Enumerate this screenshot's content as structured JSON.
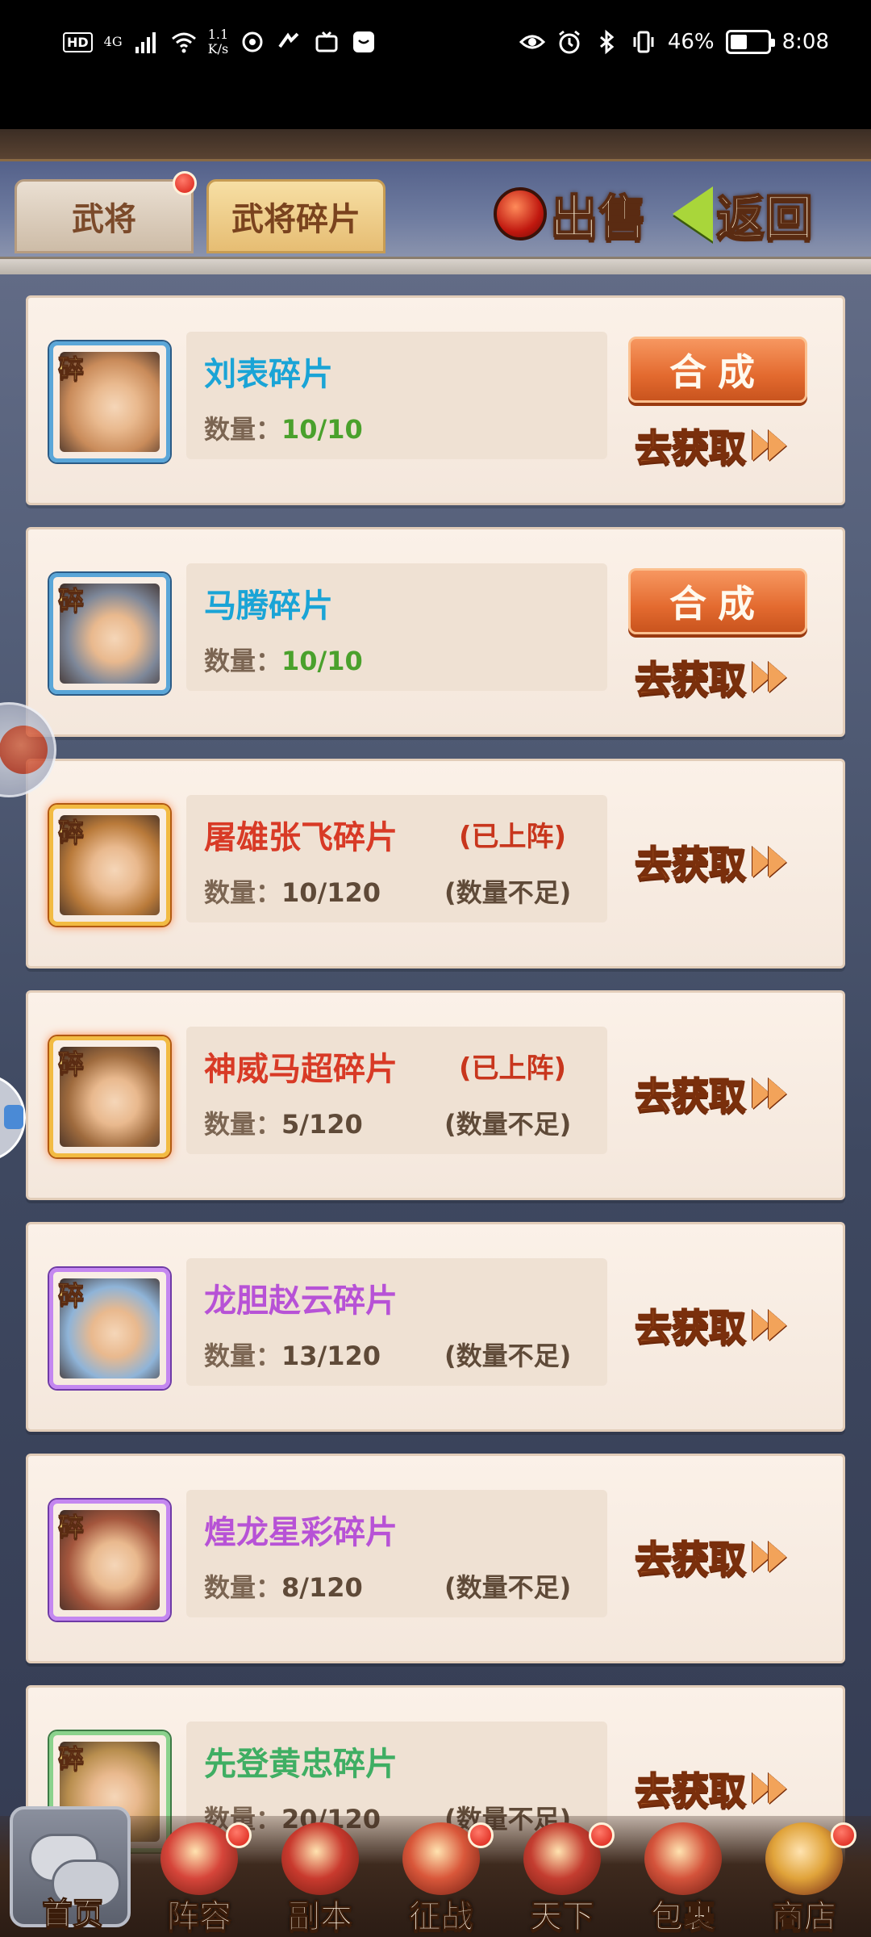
{
  "status_bar": {
    "hd": "HD",
    "signal": "4G",
    "net_speed_value": "1.1",
    "net_speed_unit": "K/s",
    "battery_percent": "46%",
    "battery_level": 0.46,
    "time": "8:08"
  },
  "header": {
    "tab_generals": "武将",
    "tab_fragments": "武将碎片",
    "sell_label": "出售",
    "back_label": "返回"
  },
  "list": {
    "fragment_tag": "碎",
    "quantity_label": "数量：",
    "compose_label": "合成",
    "obtain_label": "去获取",
    "items": [
      {
        "name": "刘表碎片",
        "name_color": "#1aa4d6",
        "quantity": "10/10",
        "qty_color": "#4aa12c",
        "status": "",
        "note": "",
        "can_compose": true,
        "frame": "blue",
        "face": "#c98b5a"
      },
      {
        "name": "马腾碎片",
        "name_color": "#1aa4d6",
        "quantity": "10/10",
        "qty_color": "#4aa12c",
        "status": "",
        "note": "",
        "can_compose": true,
        "frame": "blue",
        "face": "#7d8799"
      },
      {
        "name": "屠雄张飞碎片",
        "name_color": "#d83a26",
        "quantity": "10/120",
        "qty_color": "#5f4a38",
        "status": "(已上阵)",
        "note": "(数量不足)",
        "can_compose": false,
        "frame": "gold",
        "face": "#b97a3a"
      },
      {
        "name": "神威马超碎片",
        "name_color": "#d83a26",
        "quantity": "5/120",
        "qty_color": "#5f4a38",
        "status": "(已上阵)",
        "note": "(数量不足)",
        "can_compose": false,
        "frame": "gold",
        "face": "#9f6b3e"
      },
      {
        "name": "龙胆赵云碎片",
        "name_color": "#b752d6",
        "quantity": "13/120",
        "qty_color": "#5f4a38",
        "status": "",
        "note": "(数量不足)",
        "can_compose": false,
        "frame": "purple",
        "face": "#8fb4d8"
      },
      {
        "name": "煌龙星彩碎片",
        "name_color": "#b752d6",
        "quantity": "8/120",
        "qty_color": "#5f4a38",
        "status": "",
        "note": "(数量不足)",
        "can_compose": false,
        "frame": "purple",
        "face": "#a4563d"
      },
      {
        "name": "先登黄忠碎片",
        "name_color": "#3fae63",
        "quantity": "20/120",
        "qty_color": "#5f4a38",
        "status": "",
        "note": "(数量不足)",
        "can_compose": false,
        "frame": "green",
        "face": "#b88e4e"
      }
    ]
  },
  "bottom_nav": {
    "home": "首页",
    "items": [
      {
        "label": "阵容",
        "icon": "lineup-icon",
        "badge": true,
        "color": "#d6453a"
      },
      {
        "label": "副本",
        "icon": "dungeon-icon",
        "badge": false,
        "color": "#c93a2e"
      },
      {
        "label": "征战",
        "icon": "campaign-icon",
        "badge": true,
        "color": "#d9573a"
      },
      {
        "label": "天下",
        "icon": "world-icon",
        "badge": true,
        "color": "#c43d30"
      },
      {
        "label": "包裹",
        "icon": "bag-icon",
        "badge": false,
        "color": "#d4533b"
      },
      {
        "label": "商店",
        "icon": "shop-icon",
        "badge": true,
        "color": "#e0a33a"
      }
    ]
  }
}
